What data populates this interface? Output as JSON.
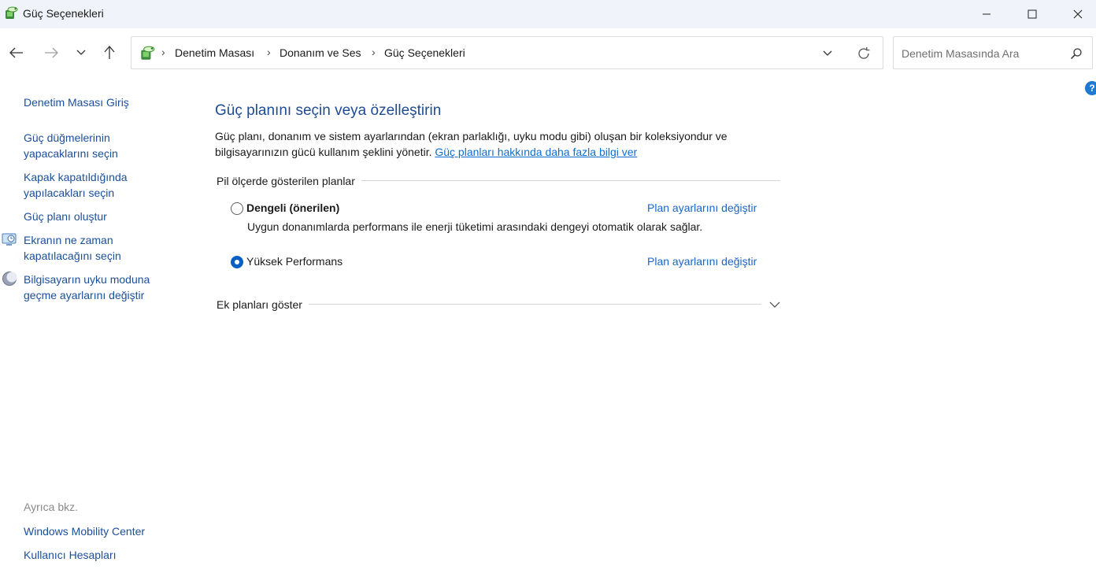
{
  "window": {
    "title": "Güç Seçenekleri",
    "icon": "power-options-icon"
  },
  "breadcrumb": {
    "items": [
      "Denetim Masası",
      "Donanım ve Ses",
      "Güç Seçenekleri"
    ],
    "separator": "›"
  },
  "search": {
    "placeholder": "Denetim Masasında Ara"
  },
  "sidebar": {
    "home": "Denetim Masası Giriş",
    "links": [
      "Güç düğmelerinin yapacaklarını seçin",
      "Kapak kapatıldığında yapılacakları seçin",
      "Güç planı oluştur",
      "Ekranın ne zaman kapatılacağını seçin",
      "Bilgisayarın uyku moduna geçme ayarlarını değiştir"
    ],
    "see_also_label": "Ayrıca bkz.",
    "see_also": [
      "Windows Mobility Center",
      "Kullanıcı Hesapları"
    ]
  },
  "main": {
    "heading": "Güç planını seçin veya özelleştirin",
    "description": "Güç planı, donanım ve sistem ayarlarından (ekran parlaklığı, uyku modu gibi) oluşan bir koleksiyondur ve bilgisayarınızın gücü kullanım şeklini yönetir.",
    "learn_more": "Güç planları hakkında daha fazla bilgi ver",
    "section_label": "Pil ölçerde gösterilen planlar",
    "plans": [
      {
        "name": "Dengeli (önerilen)",
        "description": "Uygun donanımlarda performans ile enerji tüketimi arasındaki dengeyi otomatik olarak sağlar.",
        "link": "Plan ayarlarını değiştir",
        "selected": false
      },
      {
        "name": "Yüksek Performans",
        "description": "",
        "link": "Plan ayarlarını değiştir",
        "selected": true
      }
    ],
    "more_plans": "Ek planları göster"
  },
  "colors": {
    "link": "#1b4f9b",
    "heading": "#1e4b94",
    "accent": "#0a5fc4",
    "titlebar": "#f0f3f9"
  }
}
